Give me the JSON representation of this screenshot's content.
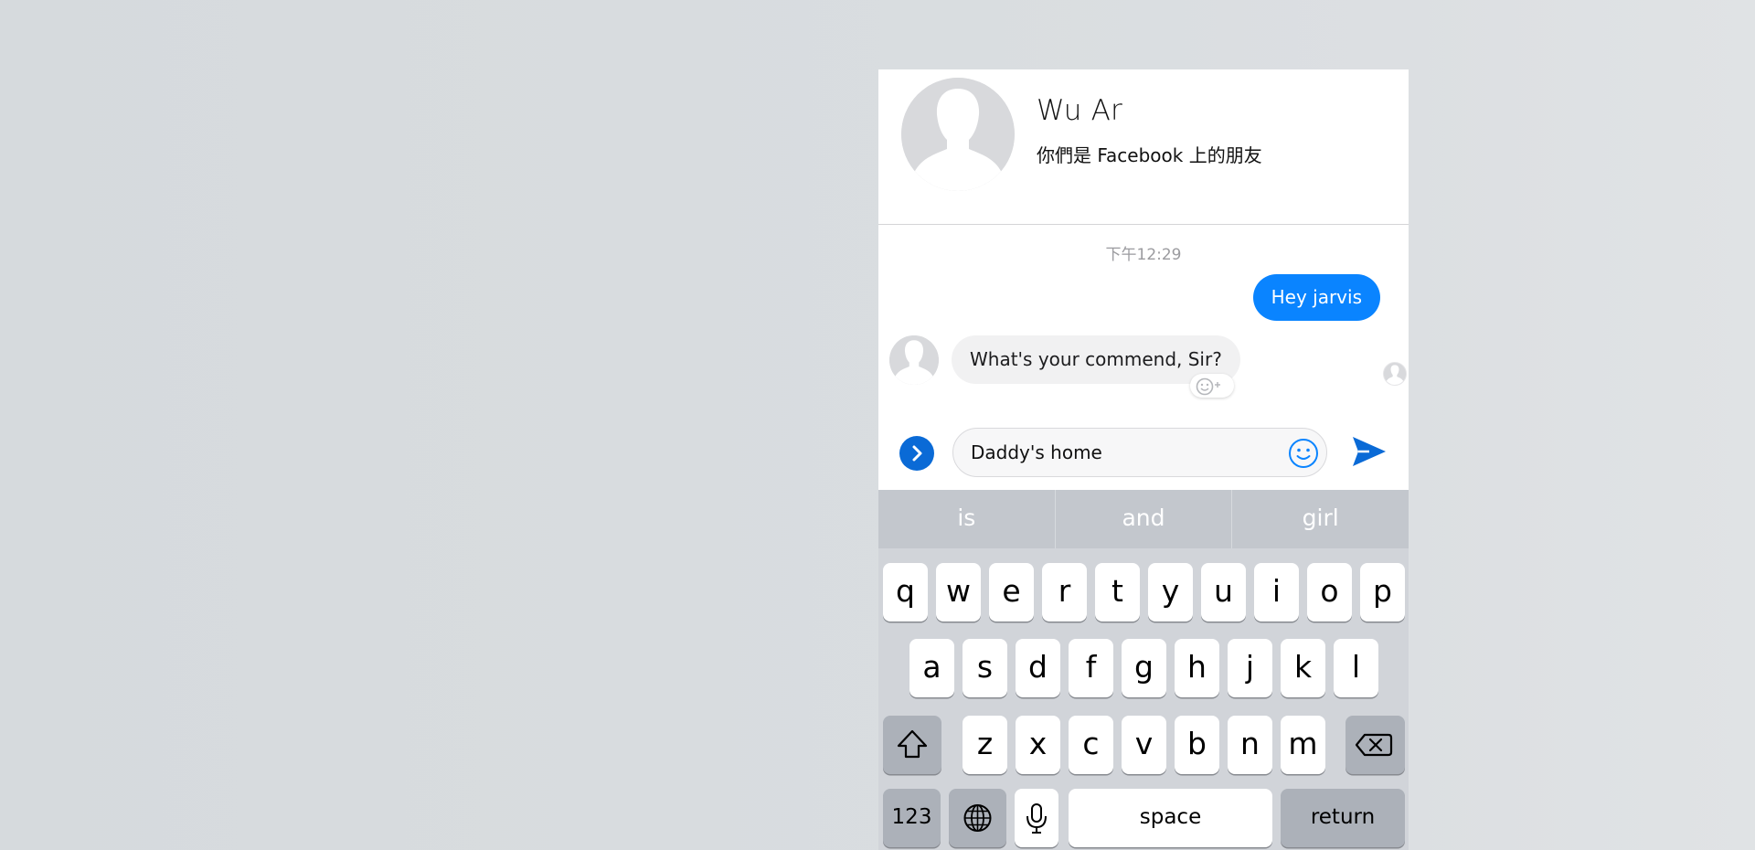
{
  "header": {
    "contact_name": "Wu Ar",
    "subtitle": "你們是 Facebook 上的朋友"
  },
  "conversation": {
    "timestamp": "下午12:29",
    "messages": [
      {
        "direction": "outgoing",
        "text": "Hey jarvis"
      },
      {
        "direction": "incoming",
        "text": "What's your commend, Sir?"
      }
    ]
  },
  "composer": {
    "input_value": "Daddy's home",
    "accent_color": "#0a84ff"
  },
  "keyboard": {
    "suggestions": [
      "is",
      "and",
      "girl"
    ],
    "row1": [
      "q",
      "w",
      "e",
      "r",
      "t",
      "y",
      "u",
      "i",
      "o",
      "p"
    ],
    "row2": [
      "a",
      "s",
      "d",
      "f",
      "g",
      "h",
      "j",
      "k",
      "l"
    ],
    "row3": [
      "z",
      "x",
      "c",
      "v",
      "b",
      "n",
      "m"
    ],
    "numbers_label": "123",
    "space_label": "space",
    "return_label": "return"
  }
}
